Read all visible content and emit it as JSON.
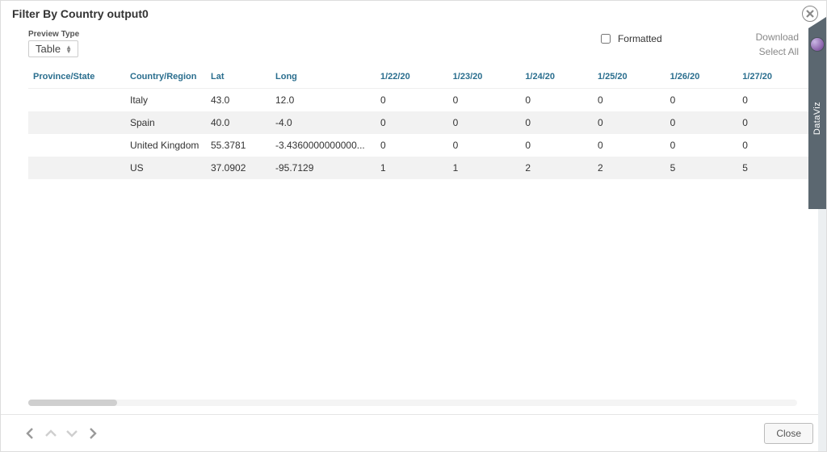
{
  "title": "Filter By Country output0",
  "preview": {
    "label": "Preview Type",
    "value": "Table"
  },
  "checkbox": {
    "formatted_label": "Formatted",
    "formatted_checked": false
  },
  "actions": {
    "download": "Download",
    "select_all": "Select All"
  },
  "sideTab": {
    "label": "DataViz"
  },
  "footer": {
    "close_label": "Close"
  },
  "columns": [
    "Province/State",
    "Country/Region",
    "Lat",
    "Long",
    "1/22/20",
    "1/23/20",
    "1/24/20",
    "1/25/20",
    "1/26/20",
    "1/27/20"
  ],
  "rows": [
    {
      "province": "",
      "country": "Italy",
      "lat": "43.0",
      "long": "12.0",
      "d0": "0",
      "d1": "0",
      "d2": "0",
      "d3": "0",
      "d4": "0",
      "d5": "0"
    },
    {
      "province": "",
      "country": "Spain",
      "lat": "40.0",
      "long": "-4.0",
      "d0": "0",
      "d1": "0",
      "d2": "0",
      "d3": "0",
      "d4": "0",
      "d5": "0"
    },
    {
      "province": "",
      "country": "United Kingdom",
      "lat": "55.3781",
      "long": "-3.4360000000000...",
      "d0": "0",
      "d1": "0",
      "d2": "0",
      "d3": "0",
      "d4": "0",
      "d5": "0"
    },
    {
      "province": "",
      "country": "US",
      "lat": "37.0902",
      "long": "-95.7129",
      "d0": "1",
      "d1": "1",
      "d2": "2",
      "d3": "2",
      "d4": "5",
      "d5": "5"
    }
  ]
}
